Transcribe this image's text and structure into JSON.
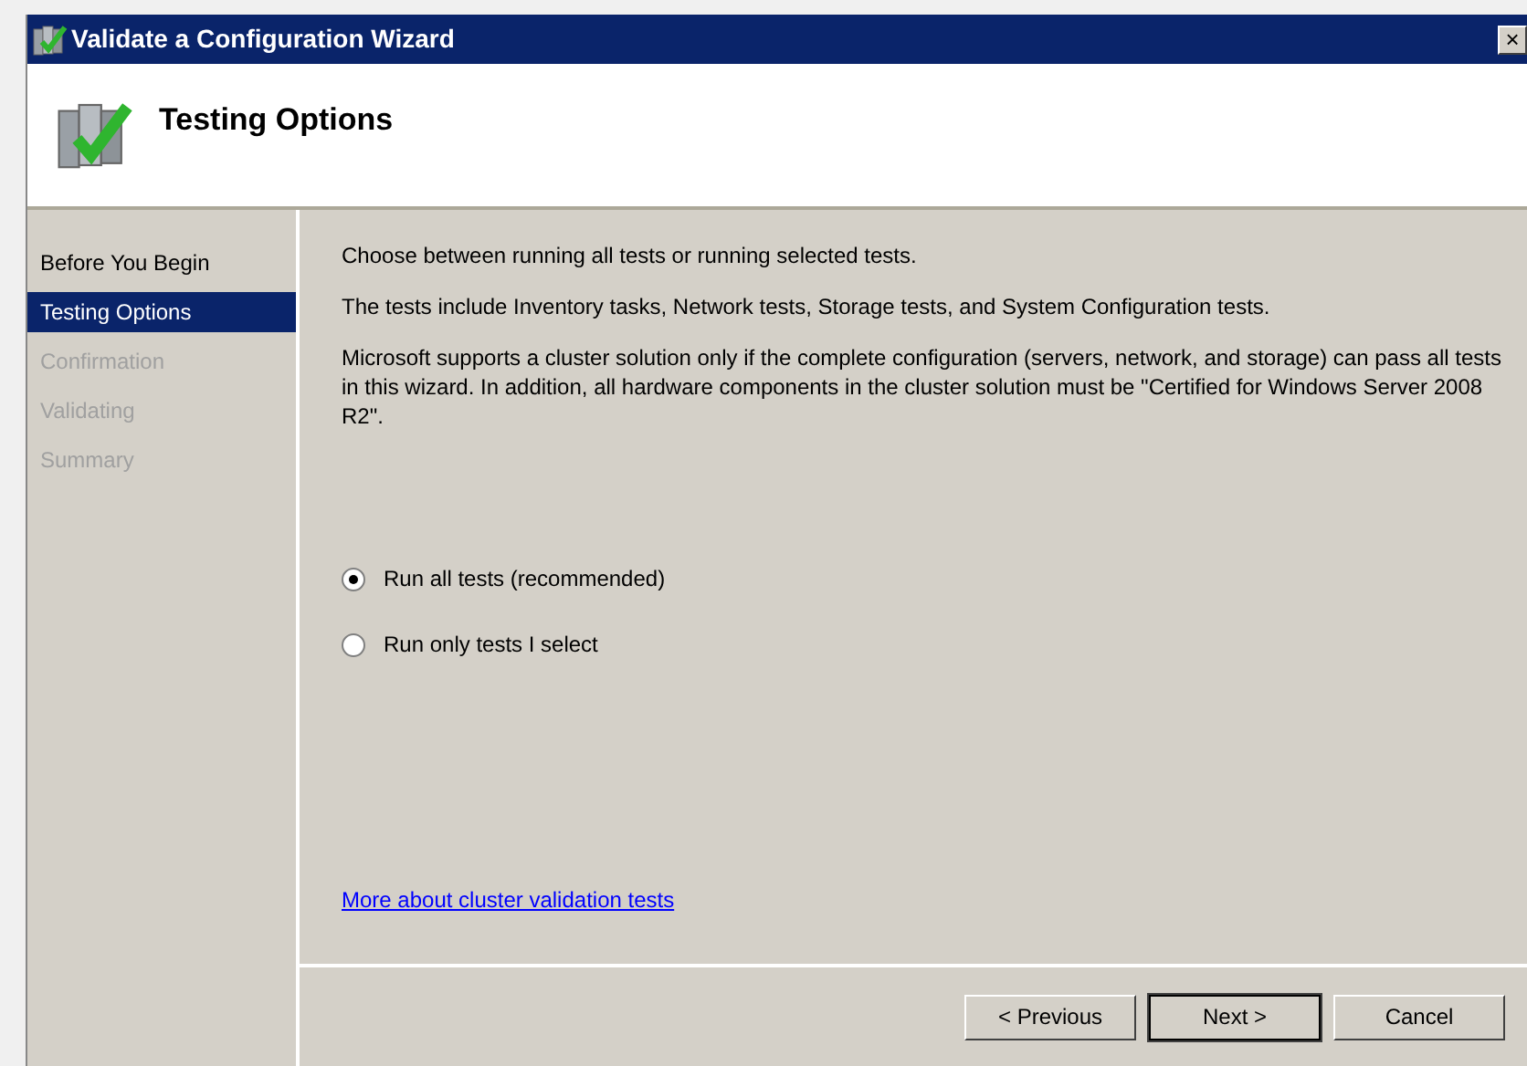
{
  "window": {
    "title": "Validate a Configuration Wizard",
    "close": "×"
  },
  "header": {
    "title": "Testing Options"
  },
  "steps": [
    {
      "label": "Before You Begin",
      "selected": false,
      "disabled": false
    },
    {
      "label": "Testing Options",
      "selected": true,
      "disabled": false
    },
    {
      "label": "Confirmation",
      "selected": false,
      "disabled": true
    },
    {
      "label": "Validating",
      "selected": false,
      "disabled": true
    },
    {
      "label": "Summary",
      "selected": false,
      "disabled": true
    }
  ],
  "paragraphs": [
    "Choose between running all tests or running selected tests.",
    "The tests include Inventory tasks, Network tests, Storage tests, and System Configuration tests.",
    "Microsoft supports a cluster solution only if the complete configuration (servers, network, and storage) can pass all tests in this wizard. In addition, all hardware components in the cluster solution must be \"Certified for Windows Server 2008 R2\"."
  ],
  "options": [
    {
      "label": "Run all tests (recommended)",
      "selected": true
    },
    {
      "label": "Run only tests I select",
      "selected": false
    }
  ],
  "link": "More about cluster validation tests",
  "buttons": [
    {
      "label": "< Previous",
      "default": false
    },
    {
      "label": "Next >",
      "default": true
    },
    {
      "label": "Cancel",
      "default": false
    }
  ]
}
